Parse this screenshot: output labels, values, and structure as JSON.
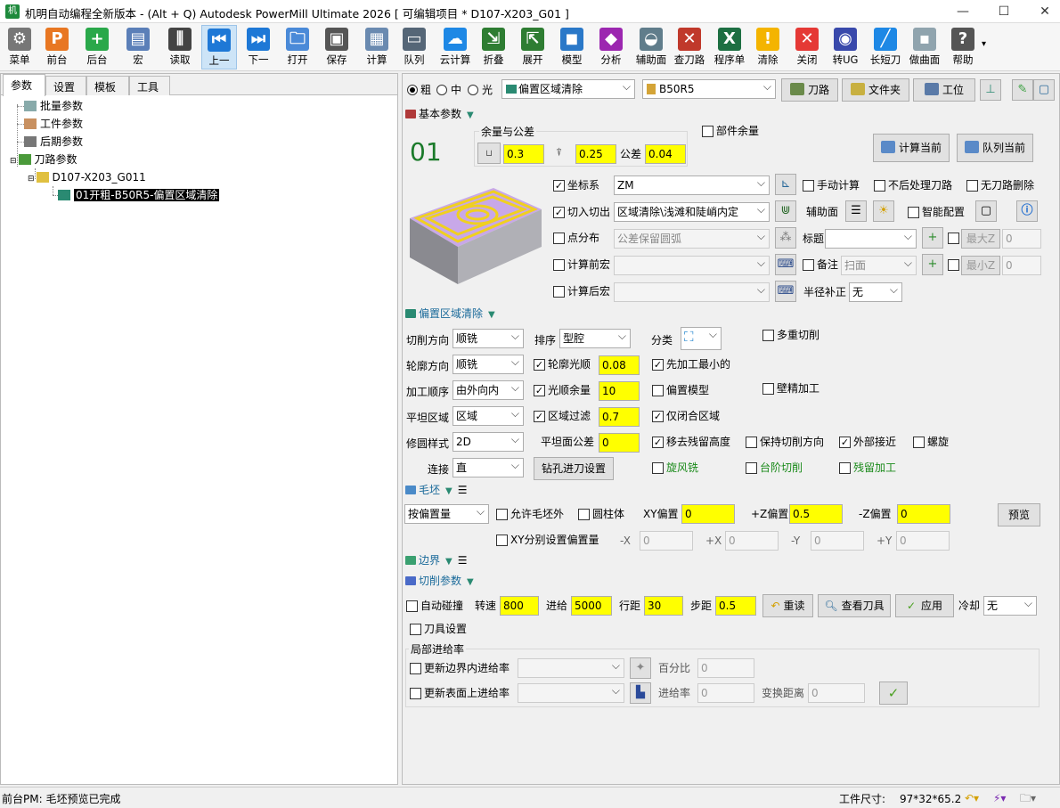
{
  "window": {
    "title": "机明自动编程全新版本 - (Alt + Q) Autodesk PowerMill Ultimate 2026    [ 可编辑项目 * D107-X203_G01 ]",
    "app_icon": "机"
  },
  "toolbar": [
    {
      "label": "菜单",
      "icon": "gear-icon",
      "color": "#777777"
    },
    {
      "label": "前台",
      "icon": "mill-icon",
      "color": "#e87722"
    },
    {
      "label": "后台",
      "icon": "plus-icon",
      "color": "#2aa84a"
    },
    {
      "label": "宏",
      "icon": "macro-icon",
      "color": "#5b7fb8"
    },
    {
      "label": "读取",
      "icon": "sliders-icon",
      "color": "#444444"
    },
    {
      "label": "上一",
      "icon": "prev-icon",
      "color": "#1e78d6"
    },
    {
      "label": "下一",
      "icon": "next-icon",
      "color": "#1e78d6"
    },
    {
      "label": "打开",
      "icon": "folder-icon",
      "color": "#4a8ad8"
    },
    {
      "label": "保存",
      "icon": "save-icon",
      "color": "#555555"
    },
    {
      "label": "计算",
      "icon": "calculator-icon",
      "color": "#6a8ab0"
    },
    {
      "label": "队列",
      "icon": "terminal-icon",
      "color": "#556677"
    },
    {
      "label": "云计算",
      "icon": "cloud-icon",
      "color": "#1e88e5"
    },
    {
      "label": "折叠",
      "icon": "collapse-icon",
      "color": "#2e7d32"
    },
    {
      "label": "展开",
      "icon": "expand-icon",
      "color": "#2e7d32"
    },
    {
      "label": "模型",
      "icon": "cube-icon",
      "color": "#2a78c8"
    },
    {
      "label": "分析",
      "icon": "analysis-icon",
      "color": "#9c27b0"
    },
    {
      "label": "辅助面",
      "icon": "surface-icon",
      "color": "#607d8b"
    },
    {
      "label": "查刀路",
      "icon": "tools-icon",
      "color": "#c0392b"
    },
    {
      "label": "程序单",
      "icon": "excel-icon",
      "color": "#1d6f42"
    },
    {
      "label": "清除",
      "icon": "warning-icon",
      "color": "#f4b400"
    },
    {
      "label": "关闭",
      "icon": "close-icon",
      "color": "#e53935"
    },
    {
      "label": "转UG",
      "icon": "ug-icon",
      "color": "#3949ab"
    },
    {
      "label": "长短刀",
      "icon": "tool-length-icon",
      "color": "#1e88e5"
    },
    {
      "label": "做曲面",
      "icon": "box-icon",
      "color": "#90a4ae"
    },
    {
      "label": "帮助",
      "icon": "help-icon",
      "color": "#555555"
    }
  ],
  "left_tabs": [
    "参数",
    "设置",
    "模板",
    "工具"
  ],
  "tree": {
    "items": [
      "批量参数",
      "工件参数",
      "后期参数",
      "刀路参数"
    ],
    "project": "D107-X203_G011",
    "toolpath": "01开粗-B50R5-偏置区域清除"
  },
  "top_row": {
    "radios": [
      "粗",
      "中",
      "光"
    ],
    "strategy": "偏置区域清除",
    "tool": "B50R5",
    "buttons": [
      "刀路",
      "文件夹",
      "工位"
    ]
  },
  "basic": {
    "title": "基本参数",
    "number": "01",
    "allowance_group": "余量与公差",
    "radial_allowance": "0.3",
    "axial_allowance": "0.25",
    "tolerance_label": "公差",
    "tolerance": "0.04",
    "part_allowance": "部件余量",
    "calc_current": "计算当前",
    "queue_current": "队列当前",
    "coord_label": "坐标系",
    "coord_value": "ZM",
    "manual_calc": "手动计算",
    "no_post": "不后处理刀路",
    "no_path_delete": "无刀路删除",
    "lead_label": "切入切出",
    "lead_value": "区域清除\\浅滩和陡峭内定",
    "aux_surface": "辅助面",
    "smart_config": "智能配置",
    "point_dist": "点分布",
    "point_value": "公差保留圆弧",
    "title_label": "标题",
    "max_z": "最大Z",
    "max_z_val": "0",
    "pre_macro": "计算前宏",
    "note_label": "备注",
    "note_value": "扫面",
    "min_z": "最小Z",
    "min_z_val": "0",
    "post_macro": "计算后宏",
    "radius_comp": "半径补正",
    "radius_comp_val": "无"
  },
  "offset": {
    "title": "偏置区域清除",
    "cut_dir_l": "切削方向",
    "cut_dir": "顺铣",
    "order_l": "排序",
    "order": "型腔",
    "classify_l": "分类",
    "multi_cut": "多重切削",
    "profile_dir_l": "轮廓方向",
    "profile_dir": "顺铣",
    "profile_smooth": "轮廓光顺",
    "profile_smooth_v": "0.08",
    "smallest_first": "先加工最小的",
    "machine_order_l": "加工顺序",
    "machine_order": "由外向内",
    "smooth_allow": "光顺余量",
    "smooth_allow_v": "10",
    "offset_model": "偏置模型",
    "wall_finish": "壁精加工",
    "flat_l": "平坦区域",
    "flat": "区域",
    "area_filter": "区域过滤",
    "area_filter_v": "0.7",
    "closed_only": "仅闭合区域",
    "arc_style_l": "修圆样式",
    "arc_style": "2D",
    "flat_tol_l": "平坦面公差",
    "flat_tol": "0",
    "remove_rest": "移去残留高度",
    "keep_dir": "保持切削方向",
    "outside_approach": "外部接近",
    "spiral": "螺旋",
    "link_l": "连接",
    "link": "直",
    "drill_lead": "钻孔进刀设置",
    "trochoidal": "旋风铣",
    "step_cut": "台阶切削",
    "rest_machining": "残留加工"
  },
  "stock": {
    "title": "毛坯",
    "mode": "按偏置量",
    "allow_outside": "允许毛坯外",
    "cylinder": "圆柱体",
    "xy_l": "XY偏置",
    "xy": "0",
    "pz_l": "+Z偏置",
    "pz": "0.5",
    "nz_l": "-Z偏置",
    "nz": "0",
    "preview": "预览",
    "xy_separate": "XY分别设置偏置量",
    "mx_l": "-X",
    "mx": "0",
    "px_l": "+X",
    "px": "0",
    "my_l": "-Y",
    "my": "0",
    "py_l": "+Y",
    "py": "0"
  },
  "boundary": {
    "title": "边界"
  },
  "cutting": {
    "title": "切削参数",
    "auto_collision": "自动碰撞",
    "speed_l": "转速",
    "speed": "800",
    "feed_l": "进给",
    "feed": "5000",
    "stepover_l": "行距",
    "stepover": "30",
    "stepdown_l": "步距",
    "stepdown": "0.5",
    "reread": "重读",
    "view_tool": "查看刀具",
    "apply": "应用",
    "coolant_l": "冷却",
    "coolant": "无",
    "tool_settings": "刀具设置",
    "local_feed": "局部进给率",
    "update_boundary_feed": "更新边界内进给率",
    "percent_l": "百分比",
    "percent": "0",
    "update_surface_feed": "更新表面上进给率",
    "feed_rate_l": "进给率",
    "feed_rate": "0",
    "transition_l": "变换距离",
    "transition": "0"
  },
  "status": {
    "left": "前台PM: 毛坯预览已完成",
    "size_label": "工件尺寸:",
    "size_value": "97*32*65.2"
  }
}
